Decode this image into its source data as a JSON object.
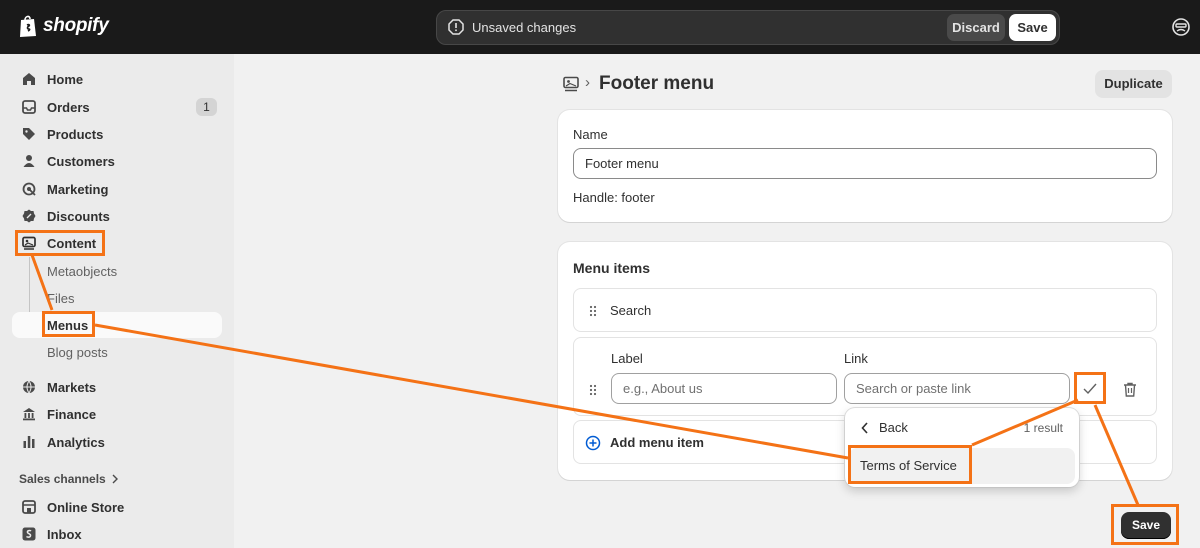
{
  "topbar": {
    "logo_text": "shopify",
    "unsaved_text": "Unsaved changes",
    "discard_label": "Discard",
    "save_label": "Save"
  },
  "sidebar": {
    "items": [
      {
        "label": "Home",
        "icon": "home-icon"
      },
      {
        "label": "Orders",
        "icon": "inbox-icon",
        "badge": "1"
      },
      {
        "label": "Products",
        "icon": "tag-icon"
      },
      {
        "label": "Customers",
        "icon": "person-icon"
      },
      {
        "label": "Marketing",
        "icon": "target-icon"
      },
      {
        "label": "Discounts",
        "icon": "discount-icon"
      },
      {
        "label": "Content",
        "icon": "content-icon"
      }
    ],
    "content_sub": [
      {
        "label": "Metaobjects"
      },
      {
        "label": "Files"
      },
      {
        "label": "Menus"
      },
      {
        "label": "Blog posts"
      }
    ],
    "items2": [
      {
        "label": "Markets",
        "icon": "globe-icon"
      },
      {
        "label": "Finance",
        "icon": "bank-icon"
      },
      {
        "label": "Analytics",
        "icon": "bar-chart-icon"
      }
    ],
    "sales_channels_label": "Sales channels",
    "channels": [
      {
        "label": "Online Store",
        "icon": "store-icon"
      },
      {
        "label": "Inbox",
        "icon": "shopify-inbox-icon"
      }
    ]
  },
  "page": {
    "title": "Footer menu",
    "duplicate_label": "Duplicate"
  },
  "name_card": {
    "name_label": "Name",
    "name_value": "Footer menu",
    "handle_text": "Handle: footer"
  },
  "menu_card": {
    "title": "Menu items",
    "item1": "Search",
    "label_field_label": "Label",
    "label_placeholder": "e.g., About us",
    "link_field_label": "Link",
    "link_placeholder": "Search or paste link",
    "add_label": "Add menu item"
  },
  "dropdown": {
    "back_label": "Back",
    "result_count": "1 result",
    "option": "Terms of Service"
  },
  "bottom": {
    "save_label": "Save"
  },
  "colors": {
    "annotation": "#f47216",
    "topbar_bg": "#1a1a1a",
    "primary_btn": "#303030"
  }
}
